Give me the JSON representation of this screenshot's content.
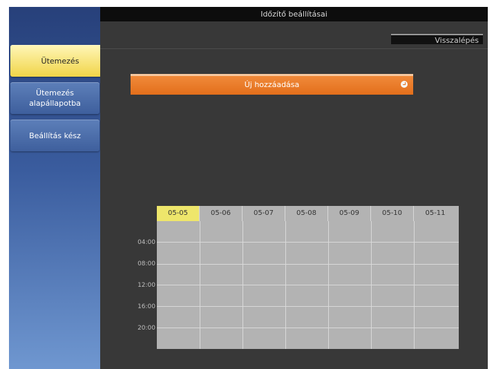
{
  "window": {
    "title": "Időzítő beállításai"
  },
  "toolbar": {
    "back_label": "Visszalépés"
  },
  "sidebar": {
    "items": [
      {
        "label": "Ütemezés",
        "active": true
      },
      {
        "label": "Ütemezés alapállapotba",
        "active": false
      },
      {
        "label": "Beállítás kész",
        "active": false
      }
    ]
  },
  "main": {
    "add_label": "Új hozzáadása",
    "add_icon": "enter-icon"
  },
  "schedule": {
    "days": [
      "05-05",
      "05-06",
      "05-07",
      "05-08",
      "05-09",
      "05-10",
      "05-11"
    ],
    "selected_day": "05-05",
    "times": [
      "04:00",
      "08:00",
      "12:00",
      "16:00",
      "20:00"
    ]
  },
  "colors": {
    "accent_orange": "#e36f1b",
    "active_yellow": "#f1d548",
    "sidebar_blue": "#3a5c9e",
    "today_highlight": "#eee66b"
  }
}
